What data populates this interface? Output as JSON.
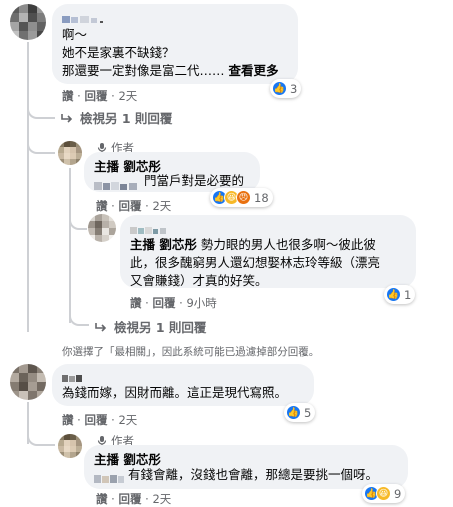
{
  "comments": [
    {
      "id": "c1",
      "user": "",
      "lines": [
        "啊～",
        "她不是家裏不缺錢？",
        "那還要一定對像是富二代……"
      ],
      "see_more": "查看更多",
      "actions": {
        "like": "讚",
        "reply": "回覆",
        "time": "2天"
      },
      "reactions": {
        "count": "3",
        "types": [
          "like"
        ]
      }
    },
    {
      "id": "c1r1",
      "author_badge": "作者",
      "user": "主播 劉芯彤",
      "text": "門當戶對是必要的",
      "actions": {
        "like": "讚",
        "reply": "回覆",
        "time": "2天"
      },
      "reactions": {
        "count": "18",
        "types": [
          "like",
          "haha",
          "angry"
        ]
      }
    },
    {
      "id": "c1r2",
      "tag": "主播 劉芯彤",
      "text_lines": [
        " 勢力眼的男人也很多啊～彼此彼",
        "此，很多醜窮男人還幻想娶林志玲等級（漂亮",
        "又會賺錢）才真的好笑。"
      ],
      "actions": {
        "like": "讚",
        "reply": "回覆",
        "time": "9小時"
      },
      "reactions": {
        "count": "1",
        "types": [
          "like"
        ]
      }
    },
    {
      "id": "c2",
      "text": "為錢而嫁，因財而離。這正是現代寫照。",
      "actions": {
        "like": "讚",
        "reply": "回覆",
        "time": "2天"
      },
      "reactions": {
        "count": "5",
        "types": [
          "like"
        ]
      }
    },
    {
      "id": "c2r1",
      "author_badge": "作者",
      "user": "主播 劉芯彤",
      "text": "有錢會離，沒錢也會離，那總是要挑一個呀。",
      "actions": {
        "like": "讚",
        "reply": "回覆",
        "time": "2天"
      },
      "reactions": {
        "count": "9",
        "types": [
          "like",
          "haha"
        ]
      }
    }
  ],
  "more_replies_1": "檢視另 1 則回覆",
  "more_replies_2": "檢視另 1 則回覆",
  "filter_note": "你選擇了「最相關」，因此系統可能已過濾掉部分回覆。",
  "colors": {
    "bubble": "#f0f2f5",
    "secondary_text": "#65676b",
    "like": "#1877f2"
  }
}
